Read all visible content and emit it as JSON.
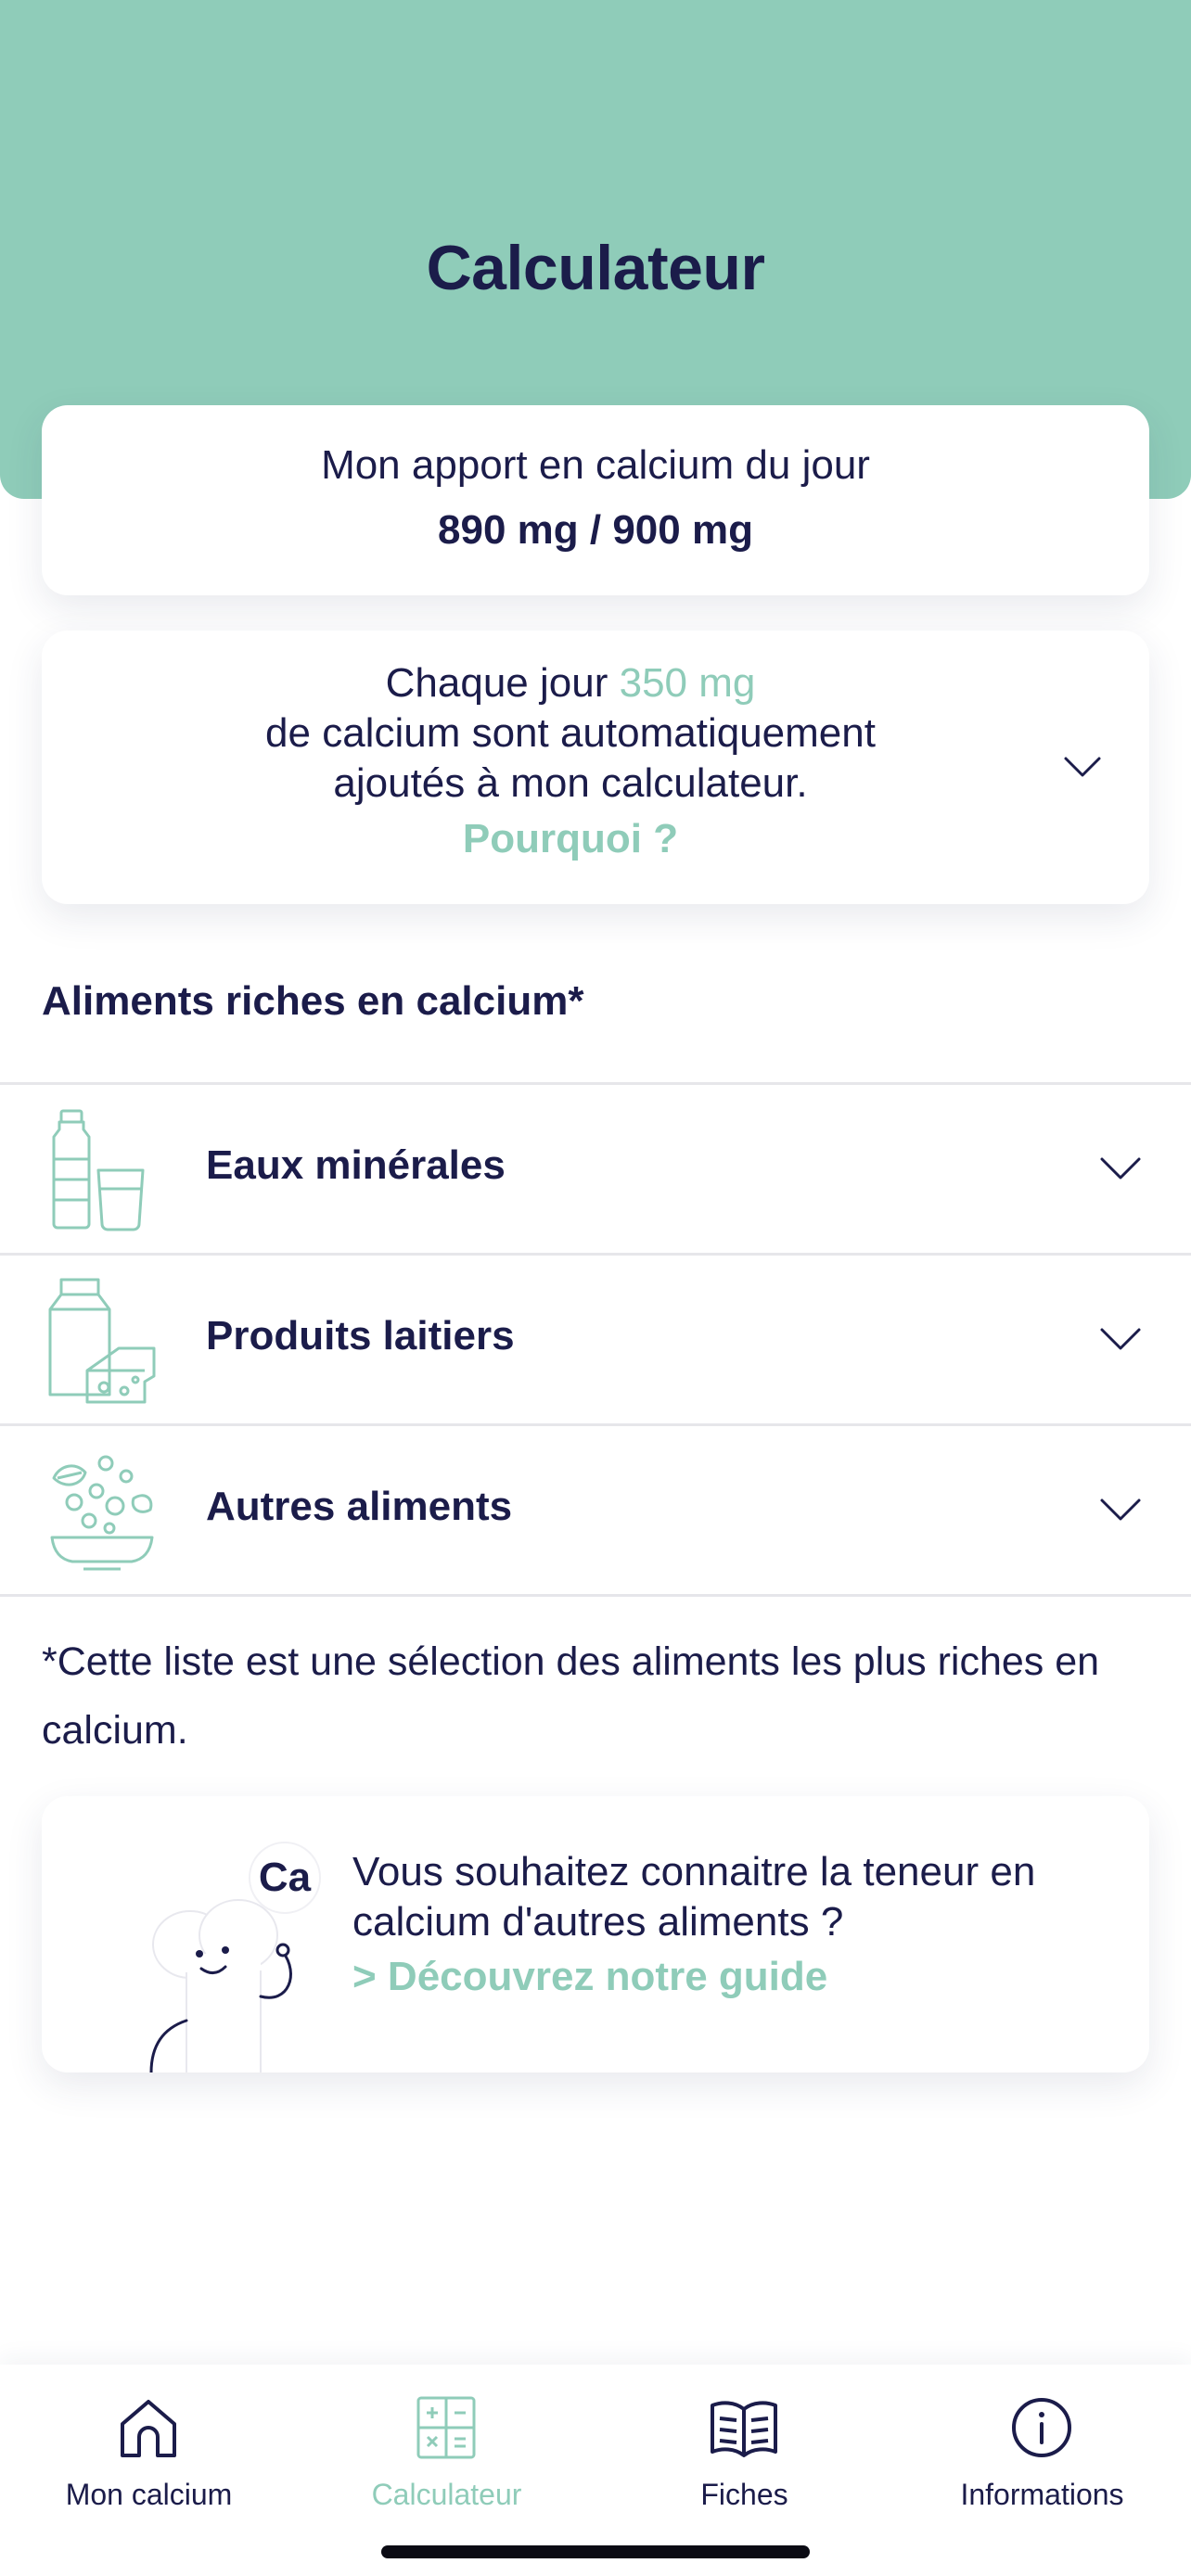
{
  "header": {
    "title": "Calculateur",
    "background": "#8fccb9"
  },
  "intake_card": {
    "label": "Mon apport en calcium du jour",
    "value": "890 mg / 900 mg"
  },
  "auto_card": {
    "prefix": "Chaque jour ",
    "amount": "350 mg",
    "line2": "de calcium sont automatiquement",
    "line3": "ajoutés à mon calculateur.",
    "why_link": "Pourquoi ?",
    "icon": "chevron-down-icon"
  },
  "foods_section": {
    "title": "Aliments riches en calcium*",
    "items": [
      {
        "label": "Eaux minérales",
        "icon": "water-bottle-icon"
      },
      {
        "label": "Produits laitiers",
        "icon": "dairy-icon"
      },
      {
        "label": "Autres aliments",
        "icon": "food-bowl-icon"
      }
    ],
    "footnote": "*Cette liste est une sélection des aliments les plus riches en calcium."
  },
  "guide_card": {
    "mascot_badge": "Ca",
    "text": "Vous souhaitez connaitre la teneur en calcium d'autres aliments ?",
    "link": "> Découvrez notre guide"
  },
  "tabbar": {
    "active": "Calculateur",
    "tabs": [
      {
        "label": "Mon calcium",
        "icon": "home-icon"
      },
      {
        "label": "Calculateur",
        "icon": "calculator-icon"
      },
      {
        "label": "Fiches",
        "icon": "book-icon"
      },
      {
        "label": "Informations",
        "icon": "info-icon"
      }
    ]
  },
  "colors": {
    "accent": "#8fccb9",
    "text": "#1b1c4a",
    "divider": "#e6e6ea"
  }
}
